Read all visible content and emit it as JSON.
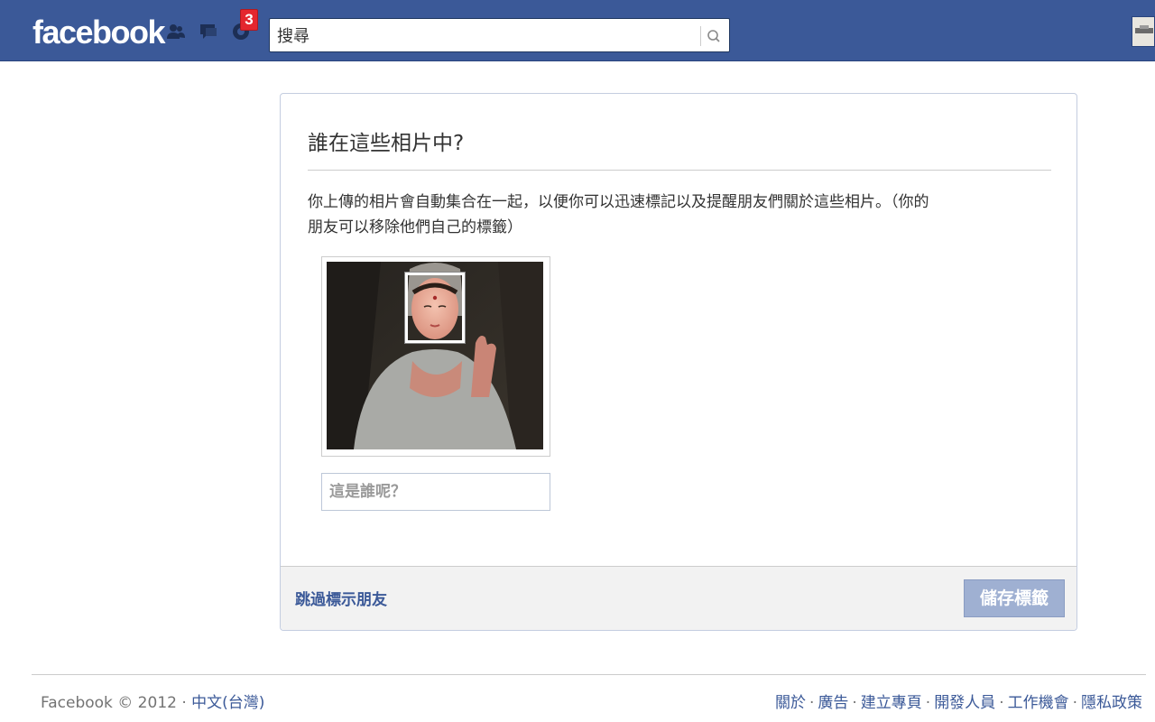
{
  "header": {
    "logo": "facebook",
    "notification_count": "3",
    "search": {
      "value": "搜尋",
      "placeholder": "搜尋"
    }
  },
  "dialog": {
    "title": "誰在這些相片中?",
    "description_line1": "你上傳的相片會自動集合在一起，以便你可以迅速標記以及提醒朋友們關於這些相片。（你的",
    "description_line2": "朋友可以移除他們自己的標籤）",
    "tag_placeholder": "這是誰呢？",
    "skip_label": "跳過標示朋友",
    "save_label": "儲存標籤"
  },
  "footer": {
    "copyright": "Facebook © 2012",
    "separator": " · ",
    "language": "中文(台灣)",
    "links": [
      "關於",
      "廣告",
      "建立專頁",
      "開發人員",
      "工作機會",
      "隱私政策"
    ]
  },
  "colors": {
    "brand": "#3b5998",
    "badge": "#e4262e",
    "save_button_disabled": "#9fb0d2"
  }
}
